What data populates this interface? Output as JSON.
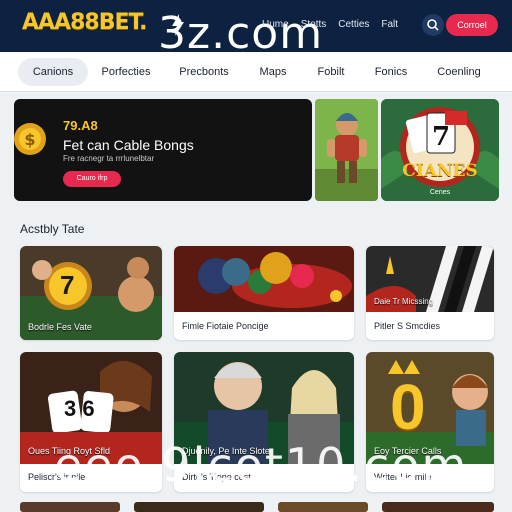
{
  "header": {
    "logo": "AAA88BET.",
    "watermark": "3z.com",
    "nav": [
      "Uume",
      "Stotts",
      "Cetties",
      "Falt"
    ],
    "login_label": "Corroel"
  },
  "categories": [
    "Canions",
    "Porfecties",
    "Precbonts",
    "Maps",
    "Fobilt",
    "Fonics",
    "Coenling"
  ],
  "banner": {
    "amount": "79.A8",
    "title": "Fet can Cable Bongs",
    "subtitle": "Fre racnegr ta rrrlunelbtar",
    "button_label": "Cauro ifrp"
  },
  "promo": {
    "title": "CIANES",
    "subtitle": "Cenes"
  },
  "section_title": "Acstbly Tate",
  "cards": [
    {
      "label": "Bodrle Fes Vate",
      "badge": "7"
    },
    {
      "label": "Fimle Fiotaie Poncige"
    },
    {
      "label": "Pitler S Smcdies",
      "caption": "Daie Tr Micssing"
    },
    {
      "label": "Peliscr's ir nile",
      "caption": "Oues Tiing Royt Sfld",
      "dice": "3 6"
    },
    {
      "label": "Dirtd's Tiope cest",
      "caption": "Djuenily, Pe Inte Slote"
    },
    {
      "label": "Writer Lio mile",
      "caption": "Eoy Tercier Calls",
      "badge": "0"
    }
  ],
  "watermark_bottom": "eeo 9lcot10.com",
  "colors": {
    "header_bg": "#0d2140",
    "accent": "#e8294f",
    "gold": "#f6c62a"
  }
}
